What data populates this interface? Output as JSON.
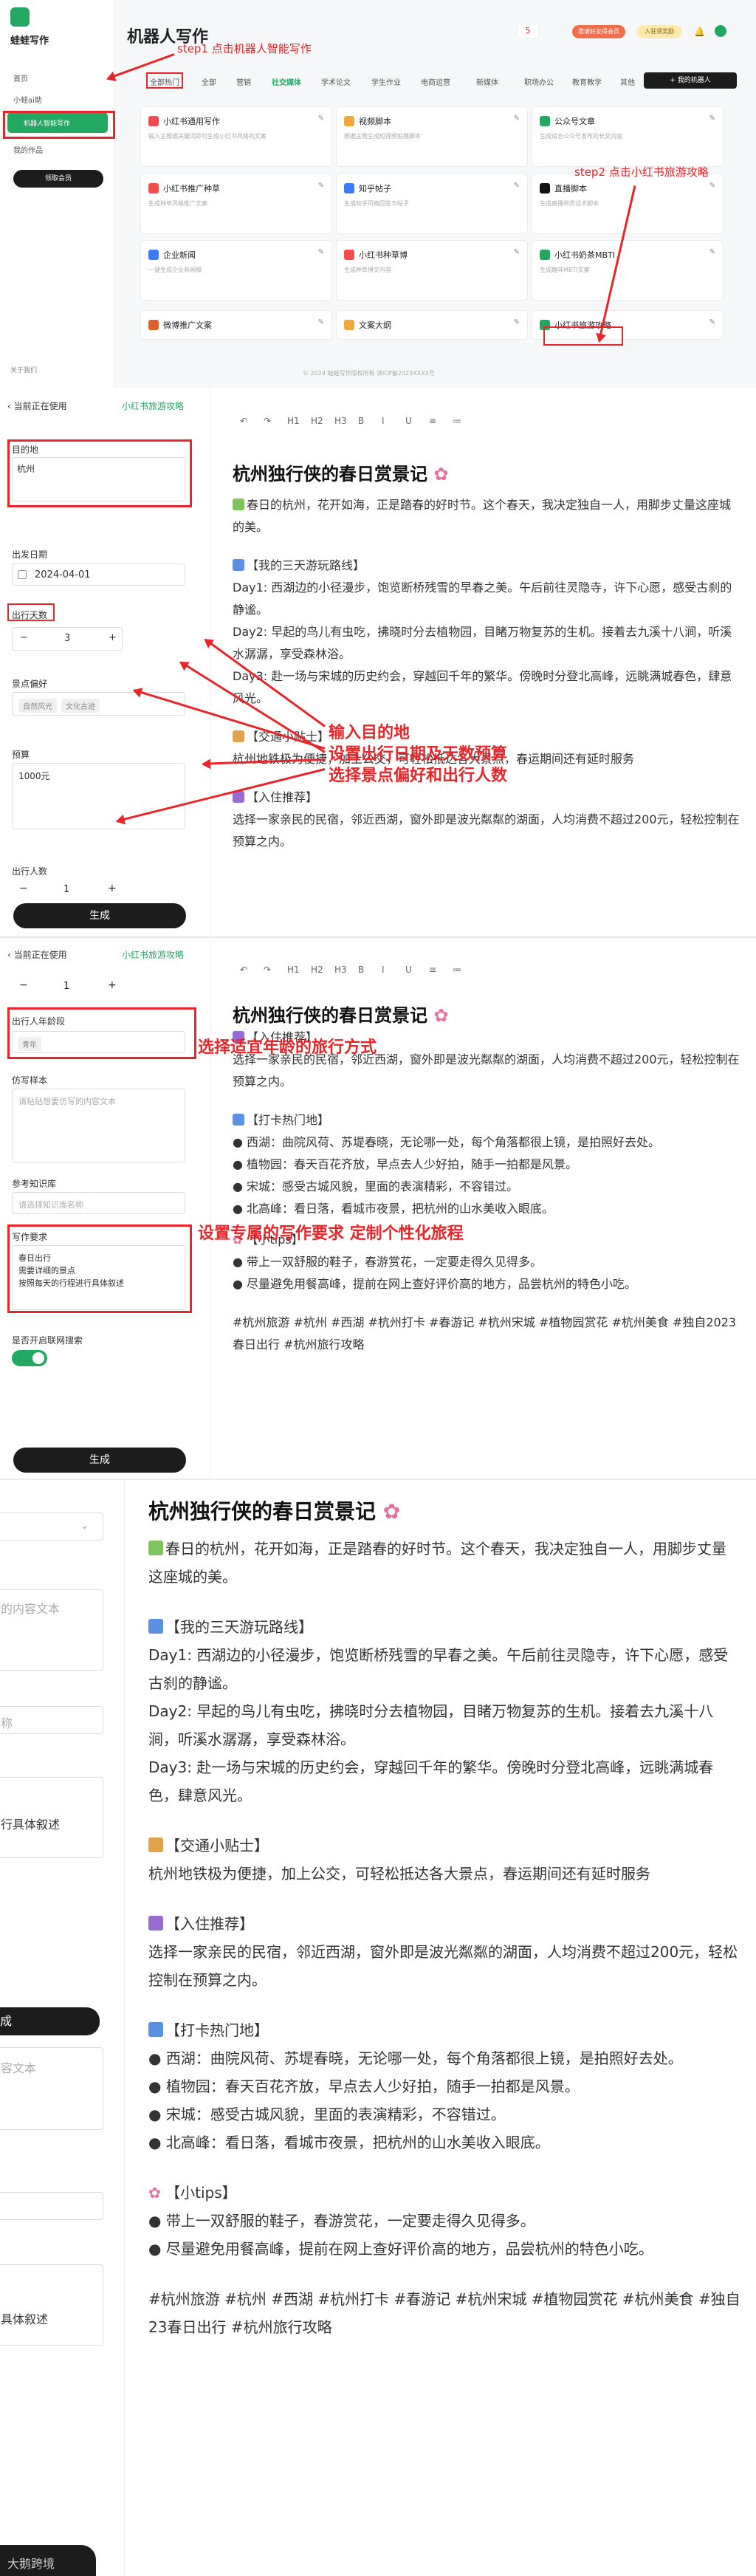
{
  "app": {
    "name": "蛙蛙写作",
    "page_title": "机器人写作",
    "footer": "© 2024 蛙蛙写作版权所有 浙ICP备2023XXXX号",
    "about": "关于我们"
  },
  "sidebar": {
    "items": [
      "首页",
      "小蛙ai助",
      "机器人智能写作",
      "我的作品"
    ],
    "upgrade": "领取会员"
  },
  "header": {
    "badge": "5",
    "btn1": "邀请好友得会员",
    "btn2": "入驻领奖励"
  },
  "tabs": [
    "全部热门",
    "全部",
    "营销",
    "社交媒体",
    "学术论文",
    "学生作业",
    "电商运营",
    "新媒体",
    "职场办公",
    "教育教学",
    "其他"
  ],
  "new_robot": "+ 我的机器人",
  "cards": [
    {
      "title": "小红书通用写作",
      "desc": "输入主题或关键词即可生成小红书风格的文案"
    },
    {
      "title": "视频脚本",
      "desc": "根据主题生成短视频拍摄脚本"
    },
    {
      "title": "公众号文章",
      "desc": "生成适合公众号发布的长文内容"
    },
    {
      "title": "小红书推广种草",
      "desc": "生成种草风格推广文案"
    },
    {
      "title": "知乎帖子",
      "desc": "生成知乎风格回答与帖子"
    },
    {
      "title": "直播脚本",
      "desc": "生成直播带货话术脚本"
    },
    {
      "title": "企业新闻",
      "desc": "一键生成企业新闻稿"
    },
    {
      "title": "小红书种草博",
      "desc": "生成种草博文内容"
    },
    {
      "title": "小红书奶茶MBTI",
      "desc": "生成趣味MBTI文案"
    },
    {
      "title": "微博推广文案",
      "desc": ""
    },
    {
      "title": "文案大纲",
      "desc": ""
    },
    {
      "title": "小红书旅游攻略",
      "desc": ""
    }
  ],
  "steps": {
    "step1": "step1 点击机器人智能写作",
    "step2": "step2 点击小红书旅游攻略"
  },
  "editor": {
    "back": "当前正在使用",
    "robot": "小红书旅游攻略",
    "dest_label": "目的地",
    "dest_value": "杭州",
    "date_label": "出发日期",
    "date_value": "2024-04-01",
    "days_label": "出行天数",
    "days_value": "3",
    "pref_label": "景点偏好",
    "pref_tags": [
      "自然风光",
      "文化古迹"
    ],
    "budget_label": "预算",
    "budget_value": "1000元",
    "people_label": "出行人数",
    "people_value": "1",
    "age_label": "出行人年龄段",
    "age_value": "青年",
    "sample_label": "仿写样本",
    "sample_placeholder": "请粘贴想要仿写的内容文本",
    "kb_label": "参考知识库",
    "kb_placeholder": "请选择知识库名称",
    "req_label": "写作要求",
    "req_value": [
      "春日出行",
      "需要详细的景点",
      "按照每天的行程进行具体叙述"
    ],
    "web_label": "是否开启联网搜索",
    "generate": "生成",
    "toolbar": [
      "↶",
      "↷",
      "H1",
      "H2",
      "H3",
      "B",
      "I",
      "U",
      "≡",
      "≔"
    ]
  },
  "annotations": {
    "a1": "输入目的地",
    "a2": "设置出行日期及天数预算",
    "a3": "选择景点偏好和出行人数",
    "a4": "选择适宜年龄的旅行方式",
    "a5": "设置专属的写作要求 定制个性化旅程"
  },
  "article": {
    "title": "杭州独行侠的春日赏景记",
    "intro": "春日的杭州，花开如海，正是踏春的好时节。这个春天，我决定独自一人，用脚步丈量这座城的美。",
    "route_title": "【我的三天游玩路线】",
    "day1": "Day1: 西湖边的小径漫步，饱览断桥残雪的早春之美。午后前往灵隐寺，许下心愿，感受古刹的静谧。",
    "day2": "Day2: 早起的鸟儿有虫吃，拂晓时分去植物园，目睹万物复苏的生机。接着去九溪十八涧，听溪水潺潺，享受森林浴。",
    "day3": "Day3: 赴一场与宋城的历史约会，穿越回千年的繁华。傍晚时分登北高峰，远眺满城春色，肆意风光。",
    "traffic_title": "【交通小贴士】",
    "traffic": "杭州地铁极为便捷，加上公交，可轻松抵达各大景点，春运期间还有延时服务",
    "stay_title": "【入住推荐】",
    "stay": "选择一家亲民的民宿，邻近西湖，窗外即是波光粼粼的湖面，人均消费不超过200元，轻松控制在预算之内。",
    "spots_title": "【打卡热门地】",
    "spots": [
      "西湖：曲院风荷、苏堤春晓，无论哪一处，每个角落都很上镜，是拍照好去处。",
      "植物园：春天百花齐放，早点去人少好拍，随手一拍都是风景。",
      "宋城：感受古城风貌，里面的表演精彩，不容错过。",
      "北高峰：看日落，看城市夜景，把杭州的山水美收入眼底。"
    ],
    "tips_title": "【小tips】",
    "tips": [
      "带上一双舒服的鞋子，春游赏花，一定要走得久见得多。",
      "尽量避免用餐高峰，提前在网上查好评价高的地方，品尝杭州的特色小吃。"
    ],
    "hashtags": "#杭州旅游 #杭州 #西湖 #杭州打卡 #春游记 #杭州宋城 #植物园赏花 #杭州美食 #独自2023春日出行 #杭州旅行攻略",
    "hashtags_b": "#杭州旅游 #杭州 #西湖 #杭州打卡 #春游记 #杭州宋城 #植物园赏花 #杭州美食 #独自",
    "hashtags_c": "23春日出行 #杭州旅行攻略"
  },
  "partial": {
    "line1": "的内容文本",
    "line2": "称",
    "line3": "行具体叙述",
    "line4": "成",
    "line5": "容文本",
    "line6": "具体叙述"
  },
  "watermark": "大鹅跨境",
  "colors": {
    "accent": "#23a862",
    "red": "#e8262a",
    "dark": "#1c1c1c"
  }
}
